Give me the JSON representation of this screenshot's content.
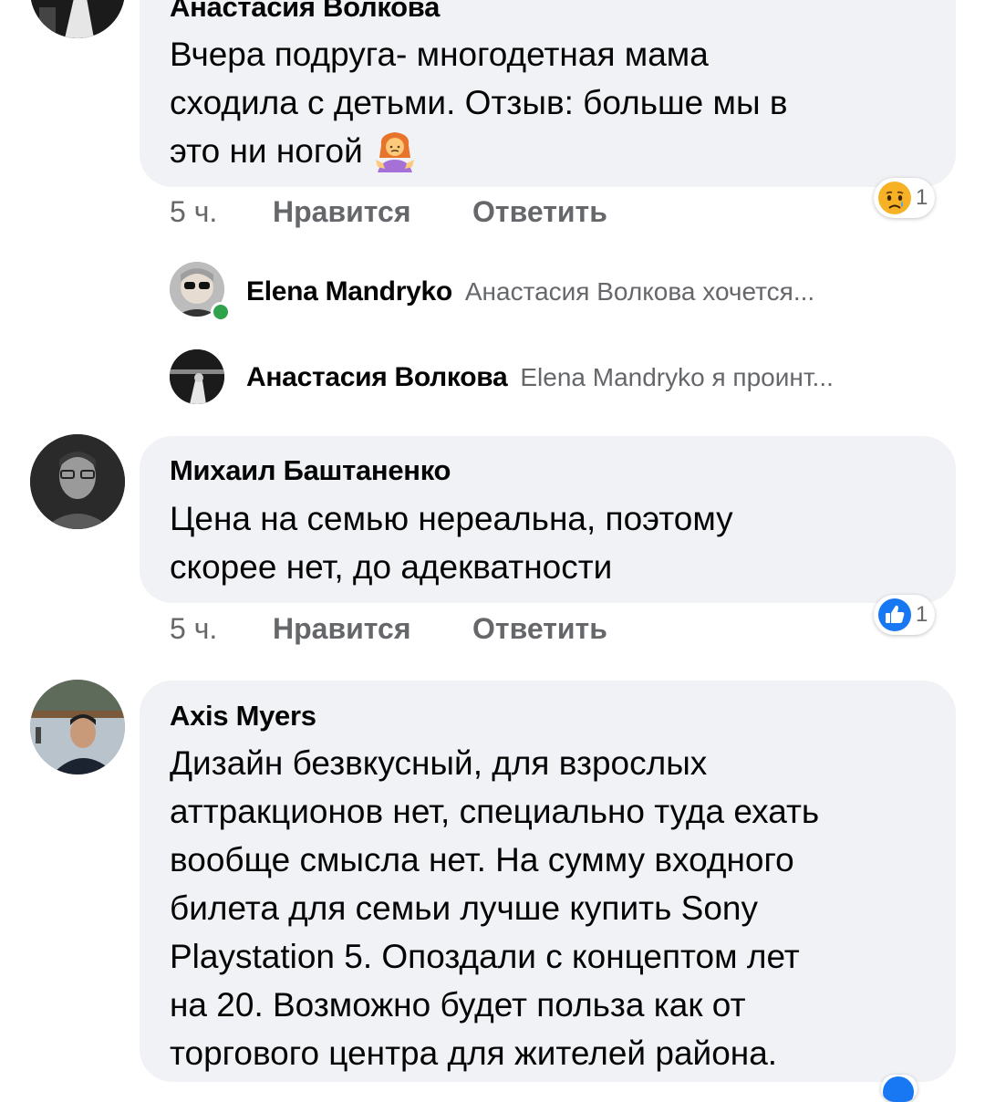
{
  "comments": [
    {
      "author": "Анастасия Волкова",
      "lines": [
        "Вчера подруга- многодетная мама",
        "сходила с детьми. Отзыв: больше мы в",
        "это ни ногой"
      ],
      "emoji": "person-shrugging-emoji",
      "time": "5 ч.",
      "like_label": "Нравится",
      "reply_label": "Ответить",
      "reaction": {
        "icon": "sad-reaction-icon",
        "count": "1"
      },
      "replies": [
        {
          "author": "Elena Mandryko",
          "preview": "Анастасия Волкова хочется...",
          "online": true
        },
        {
          "author": "Анастасия Волкова",
          "preview": "Elena Mandryko я проинт...",
          "online": false
        }
      ]
    },
    {
      "author": "Михаил Баштаненко",
      "lines": [
        "Цена на семью нереальна, поэтому",
        "скорее нет, до адекватности"
      ],
      "time": "5 ч.",
      "like_label": "Нравится",
      "reply_label": "Ответить",
      "reaction": {
        "icon": "like-reaction-icon",
        "count": "1"
      }
    },
    {
      "author": "Axis Myers",
      "lines": [
        "Дизайн безвкусный, для взрослых",
        "аттракционов нет, специально туда ехать",
        "вообще смысла нет. На сумму входного",
        "билета для семьи лучше купить Sony",
        "Playstation 5. Опоздали с концептом лет",
        "на 20. Возможно будет польза как от",
        "торгового центра для жителей района."
      ]
    }
  ],
  "colors": {
    "bubble": "#f0f2f5",
    "meta_text": "#65676b",
    "online_dot": "#31a24c",
    "like_blue": "#1877f2",
    "sad_yellow": "#f7b125"
  }
}
